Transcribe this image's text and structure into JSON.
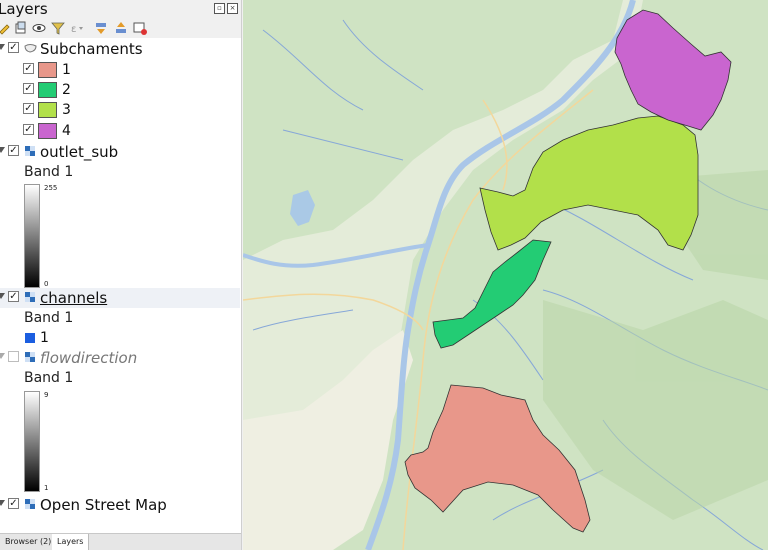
{
  "panel": {
    "title": "Layers",
    "toolbar_icons": [
      "style-icon",
      "add-group-icon",
      "visibility-icon",
      "filter-icon",
      "filter-expression-icon",
      "expand-all-icon",
      "collapse-all-icon",
      "remove-layer-icon"
    ]
  },
  "layers": {
    "subchaments": {
      "name": "Subchaments",
      "checked": true,
      "classes": [
        {
          "label": "1",
          "color": "#e8978a",
          "checked": true
        },
        {
          "label": "2",
          "color": "#23cc74",
          "checked": true
        },
        {
          "label": "3",
          "color": "#b2e04a",
          "checked": true
        },
        {
          "label": "4",
          "color": "#c965cf",
          "checked": true
        }
      ]
    },
    "outlet_sub": {
      "name": "outlet_sub",
      "checked": true,
      "band": "Band 1",
      "max": "255",
      "min": "0"
    },
    "channels": {
      "name": "channels",
      "checked": true,
      "band": "Band 1",
      "class_label": "1",
      "class_color": "#1b5ee0"
    },
    "flowdirection": {
      "name": "flowdirection",
      "checked": false,
      "band": "Band 1",
      "max": "9",
      "min": "1"
    },
    "osm": {
      "name": "Open Street Map",
      "checked": true
    }
  },
  "tabs": [
    {
      "label": "Browser (2)",
      "active": false
    },
    {
      "label": "Layers",
      "active": true
    }
  ],
  "map": {
    "background": "#cfe3c3",
    "polygons": [
      "subcatchment-1",
      "subcatchment-2",
      "subcatchment-3",
      "subcatchment-4"
    ]
  }
}
